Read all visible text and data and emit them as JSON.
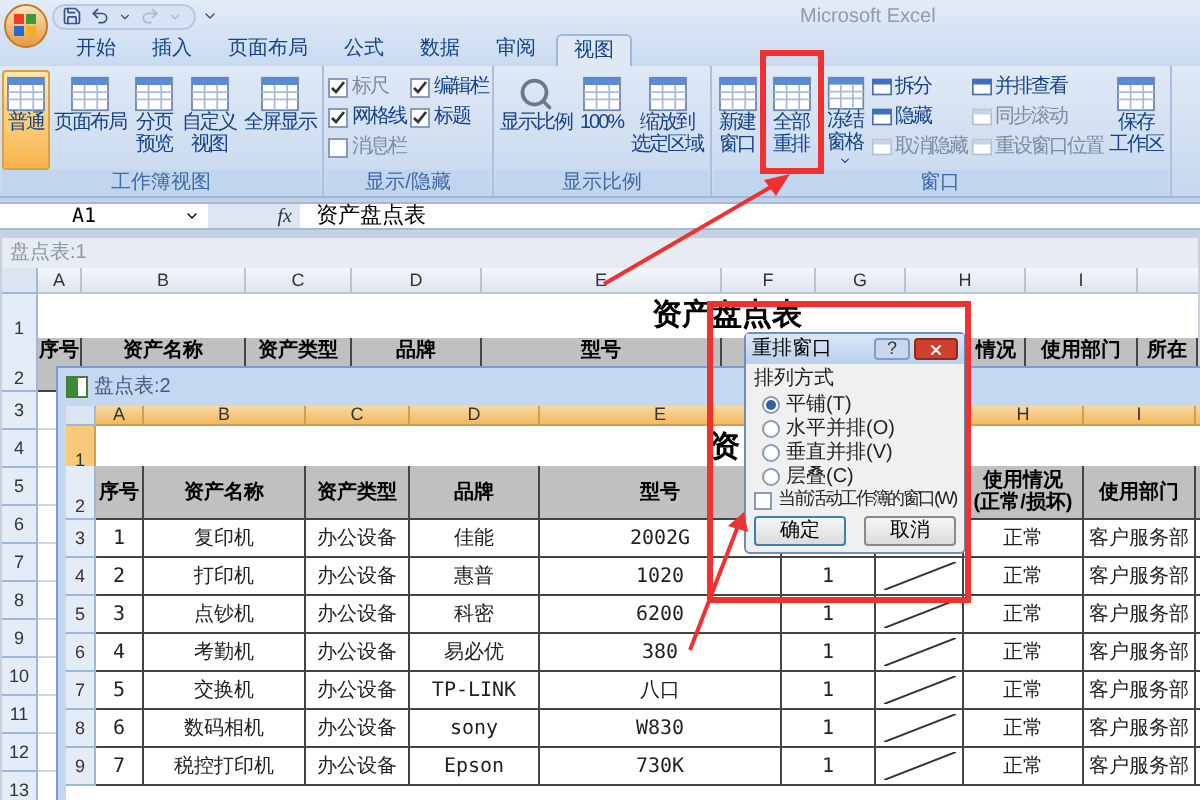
{
  "window": {
    "title": "Microsoft Excel"
  },
  "tabs": [
    {
      "label": "开始",
      "selected": false
    },
    {
      "label": "插入",
      "selected": false
    },
    {
      "label": "页面布局",
      "selected": false
    },
    {
      "label": "公式",
      "selected": false
    },
    {
      "label": "数据",
      "selected": false
    },
    {
      "label": "审阅",
      "selected": false
    },
    {
      "label": "视图",
      "selected": true
    }
  ],
  "ribbon": [
    {
      "label": "工作簿视图",
      "items": [
        {
          "kind": "large",
          "lines": [
            "普通"
          ],
          "selected": true
        },
        {
          "kind": "large",
          "lines": [
            "页面布局"
          ],
          "selected": false
        },
        {
          "kind": "large",
          "lines": [
            "分页",
            "预览"
          ],
          "selected": false
        },
        {
          "kind": "large",
          "lines": [
            "自定义",
            "视图"
          ],
          "selected": false
        },
        {
          "kind": "large",
          "lines": [
            "全屏显示"
          ],
          "selected": false
        }
      ]
    },
    {
      "label": "显示/隐藏",
      "items": [
        {
          "kind": "stack",
          "items": [
            {
              "kind": "check",
              "label": "标尺",
              "checked": true,
              "disabled": true
            },
            {
              "kind": "check",
              "label": "网格线",
              "checked": true,
              "disabled": false
            },
            {
              "kind": "check",
              "label": "消息栏",
              "checked": false,
              "disabled": true
            }
          ]
        },
        {
          "kind": "stack",
          "items": [
            {
              "kind": "check",
              "label": "编辑栏",
              "checked": true,
              "disabled": false
            },
            {
              "kind": "check",
              "label": "标题",
              "checked": true,
              "disabled": false
            }
          ]
        }
      ]
    },
    {
      "label": "显示比例",
      "items": [
        {
          "kind": "large",
          "lines": [
            "显示比例"
          ],
          "selected": false
        },
        {
          "kind": "large",
          "lines": [
            "100%"
          ],
          "selected": false
        },
        {
          "kind": "large",
          "lines": [
            "缩放到",
            "选定区域"
          ],
          "selected": false
        }
      ]
    },
    {
      "label": "窗口",
      "items": [
        {
          "kind": "large",
          "lines": [
            "新建窗口"
          ],
          "selected": false
        },
        {
          "kind": "large",
          "lines": [
            "全部重排"
          ],
          "selected": false
        },
        {
          "kind": "large_menu",
          "lines": [
            "冻结窗格"
          ],
          "selected": false
        },
        {
          "kind": "stack",
          "items": [
            {
              "kind": "small",
              "label": "拆分",
              "disabled": false
            },
            {
              "kind": "small",
              "label": "隐藏",
              "disabled": false
            },
            {
              "kind": "small",
              "label": "取消隐藏",
              "disabled": true
            }
          ]
        },
        {
          "kind": "stack",
          "items": [
            {
              "kind": "small",
              "label": "并排查看",
              "disabled": false
            },
            {
              "kind": "small",
              "label": "同步滚动",
              "disabled": true
            },
            {
              "kind": "small",
              "label": "重设窗口位置",
              "disabled": true
            }
          ]
        },
        {
          "kind": "large",
          "lines": [
            "保存",
            "工作区"
          ],
          "selected": false
        }
      ]
    }
  ],
  "formula_bar": {
    "name_box": "A1",
    "function_label": "fx",
    "value": "资产盘点表"
  },
  "workbooks": [
    {
      "title": "盘点表:1",
      "active": false,
      "columns": [
        "A",
        "B",
        "C",
        "D",
        "E",
        "F",
        "G",
        "H",
        "I"
      ],
      "row_numbers": [
        "1",
        "2",
        "3",
        "4",
        "5",
        "6",
        "7",
        "8",
        "9",
        "10",
        "11",
        "12",
        "13"
      ],
      "title_cell": "资产盘点表",
      "rows": [
        [
          "序号",
          "资产名称",
          "资产类型",
          "品牌",
          "型号",
          "",
          "",
          "情况",
          "使用部门",
          "所在"
        ]
      ]
    },
    {
      "title": "盘点表:2",
      "active": true,
      "columns": [
        "A",
        "B",
        "C",
        "D",
        "E",
        "",
        "",
        "H",
        "I"
      ],
      "row_numbers": [
        "1",
        "2",
        "3",
        "4",
        "5",
        "6",
        "7",
        "8",
        "9"
      ],
      "title_cell": "资",
      "rows": [
        [
          "序号",
          "资产名称",
          "资产类型",
          "品牌",
          "型号",
          "",
          "",
          "使用情况(正常/损坏)",
          "使用部门"
        ],
        [
          "1",
          "复印机",
          "办公设备",
          "佳能",
          "2002G",
          "",
          "",
          "正常",
          "客户服务部"
        ],
        [
          "2",
          "打印机",
          "办公设备",
          "惠普",
          "1020",
          "1",
          "",
          "正常",
          "客户服务部"
        ],
        [
          "3",
          "点钞机",
          "办公设备",
          "科密",
          "6200",
          "1",
          "",
          "正常",
          "客户服务部"
        ],
        [
          "4",
          "考勤机",
          "办公设备",
          "易必优",
          "380",
          "1",
          "",
          "正常",
          "客户服务部"
        ],
        [
          "5",
          "交换机",
          "办公设备",
          "TP-LINK",
          "八口",
          "1",
          "",
          "正常",
          "客户服务部"
        ],
        [
          "6",
          "数码相机",
          "办公设备",
          "sony",
          "W830",
          "1",
          "",
          "正常",
          "客户服务部"
        ],
        [
          "7",
          "税控打印机",
          "办公设备",
          "Epson",
          "730K",
          "1",
          "",
          "正常",
          "客户服务部"
        ]
      ]
    }
  ],
  "dialog": {
    "title": "重排窗口",
    "help": "?",
    "group_label": "排列方式",
    "options": [
      {
        "label": "平铺(T)",
        "selected": true
      },
      {
        "label": "水平并排(O)",
        "selected": false
      },
      {
        "label": "垂直并排(V)",
        "selected": false
      },
      {
        "label": "层叠(C)",
        "selected": false
      }
    ],
    "active_only": {
      "label": "当前活动工作簿的窗口(W)",
      "checked": false
    },
    "buttons": [
      "确定",
      "取消"
    ]
  }
}
